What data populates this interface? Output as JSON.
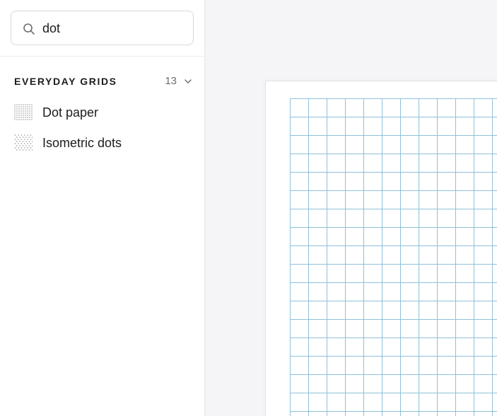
{
  "search": {
    "value": "dot",
    "icon": "search-icon"
  },
  "section": {
    "title": "EVERYDAY GRIDS",
    "count": "13",
    "icon": "chevron-down-icon"
  },
  "items": [
    {
      "label": "Dot paper",
      "icon": "dot-grid-icon"
    },
    {
      "label": "Isometric dots",
      "icon": "isometric-dots-icon"
    }
  ],
  "preview": {
    "grid_color": "#8fc1d9",
    "paper_color": "#ffffff"
  },
  "colors": {
    "text": "#1d1d1f",
    "muted": "#6e6e73",
    "canvas": "#f5f5f7",
    "border": "#d9d9de"
  }
}
